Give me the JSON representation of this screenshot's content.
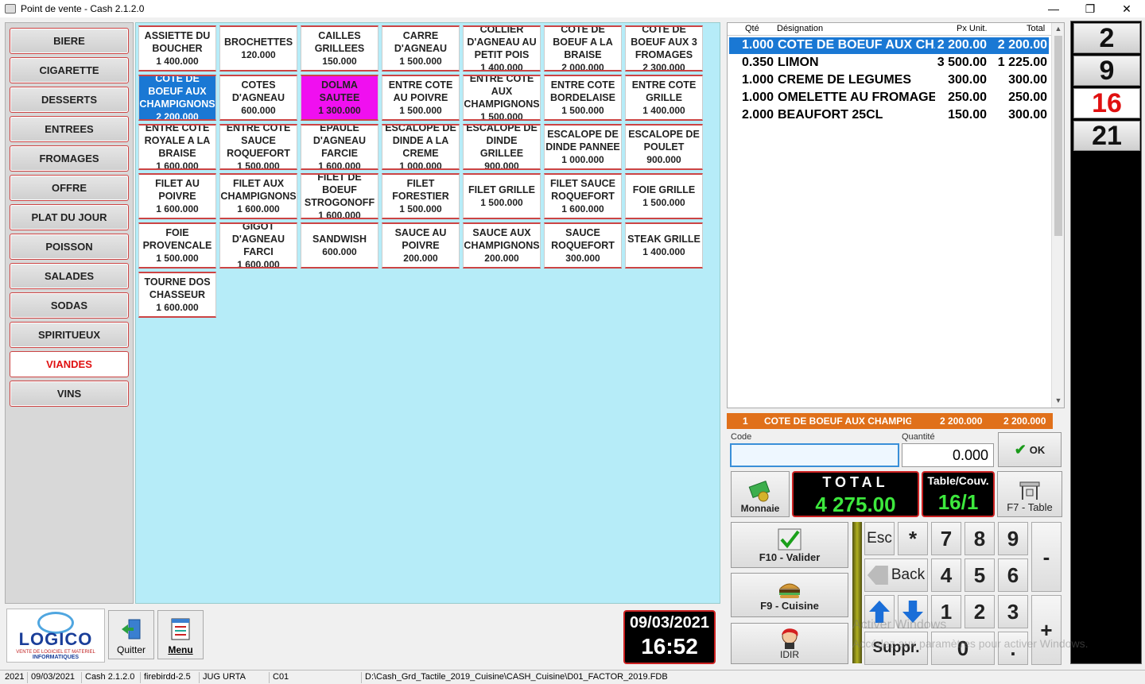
{
  "window": {
    "title": "Point de vente - Cash 2.1.2.0",
    "controls": [
      "—",
      "❐",
      "✕"
    ]
  },
  "categories": [
    "BIERE",
    "CIGARETTE",
    "DESSERTS",
    "ENTREES",
    "FROMAGES",
    "OFFRE",
    "PLAT DU JOUR",
    "POISSON",
    "SALADES",
    "SODAS",
    "SPIRITUEUX",
    "VIANDES",
    "VINS"
  ],
  "active_category": "VIANDES",
  "products": [
    {
      "name": "ASSIETTE DU BOUCHER",
      "price": "1 400.000"
    },
    {
      "name": "BROCHETTES",
      "price": "120.000"
    },
    {
      "name": "CAILLES GRILLEES",
      "price": "150.000"
    },
    {
      "name": "CARRE D'AGNEAU",
      "price": "1 500.000"
    },
    {
      "name": "COLLIER D'AGNEAU AU PETIT POIS",
      "price": "1 400.000"
    },
    {
      "name": "COTE DE BOEUF A LA BRAISE",
      "price": "2 000.000"
    },
    {
      "name": "COTE DE BOEUF AUX 3 FROMAGES",
      "price": "2 300.000"
    },
    {
      "name": "COTE DE BOEUF AUX CHAMPIGNONS",
      "price": "2 200.000",
      "state": "sel-blue"
    },
    {
      "name": "COTES D'AGNEAU",
      "price": "600.000"
    },
    {
      "name": "DOLMA SAUTEE",
      "price": "1 300.000",
      "state": "sel-pink"
    },
    {
      "name": "ENTRE COTE AU POIVRE",
      "price": "1 500.000"
    },
    {
      "name": "ENTRE COTE AUX CHAMPIGNONS",
      "price": "1 500.000"
    },
    {
      "name": "ENTRE COTE BORDELAISE",
      "price": "1 500.000"
    },
    {
      "name": "ENTRE COTE GRILLE",
      "price": "1 400.000"
    },
    {
      "name": "ENTRE COTE ROYALE A LA BRAISE",
      "price": "1 600.000"
    },
    {
      "name": "ENTRE COTE SAUCE ROQUEFORT",
      "price": "1 500.000"
    },
    {
      "name": "EPAULE D'AGNEAU FARCIE",
      "price": "1 600.000"
    },
    {
      "name": "ESCALOPE DE DINDE A LA CREME",
      "price": "1 000.000"
    },
    {
      "name": "ESCALOPE DE DINDE GRILLEE",
      "price": "900.000"
    },
    {
      "name": "ESCALOPE DE DINDE PANNEE",
      "price": "1 000.000"
    },
    {
      "name": "ESCALOPE DE POULET",
      "price": "900.000"
    },
    {
      "name": "FILET AU POIVRE",
      "price": "1 600.000"
    },
    {
      "name": "FILET AUX CHAMPIGNONS",
      "price": "1 600.000"
    },
    {
      "name": "FILET DE BOEUF STROGONOFF",
      "price": "1 600.000"
    },
    {
      "name": "FILET FORESTIER",
      "price": "1 500.000"
    },
    {
      "name": "FILET GRILLE",
      "price": "1 500.000"
    },
    {
      "name": "FILET SAUCE ROQUEFORT",
      "price": "1 600.000"
    },
    {
      "name": "FOIE GRILLE",
      "price": "1 500.000"
    },
    {
      "name": "FOIE PROVENCALE",
      "price": "1 500.000"
    },
    {
      "name": "GIGOT D'AGNEAU FARCI",
      "price": "1 600.000"
    },
    {
      "name": "SANDWISH",
      "price": "600.000"
    },
    {
      "name": "SAUCE AU POIVRE",
      "price": "200.000"
    },
    {
      "name": "SAUCE AUX CHAMPIGNONS",
      "price": "200.000"
    },
    {
      "name": "SAUCE ROQUEFORT",
      "price": "300.000"
    },
    {
      "name": "STEAK GRILLE",
      "price": "1 400.000"
    },
    {
      "name": "TOURNE DOS CHASSEUR",
      "price": "1 600.000"
    }
  ],
  "order": {
    "headers": {
      "qty": "Qté",
      "designation": "Désignation",
      "unit_price": "Px Unit.",
      "total": "Total"
    },
    "lines": [
      {
        "qty": "1.000",
        "designation": "COTE DE BOEUF AUX CHAMPIGNONS",
        "unit_price": "2 200.00",
        "total": "2 200.00",
        "selected": true
      },
      {
        "qty": "0.350",
        "designation": "LIMON",
        "unit_price": "3 500.00",
        "total": "1 225.00"
      },
      {
        "qty": "1.000",
        "designation": "CREME DE LEGUMES",
        "unit_price": "300.00",
        "total": "300.00"
      },
      {
        "qty": "1.000",
        "designation": "OMELETTE AU FROMAGE",
        "unit_price": "250.00",
        "total": "250.00"
      },
      {
        "qty": "2.000",
        "designation": "BEAUFORT 25CL",
        "unit_price": "150.00",
        "total": "300.00"
      }
    ]
  },
  "selected_line": {
    "index": "1",
    "designation": "COTE DE BOEUF AUX CHAMPIGNONS",
    "unit_price": "2 200.000",
    "total": "2 200.000"
  },
  "inputs": {
    "code_label": "Code",
    "code_value": "",
    "qty_label": "Quantité",
    "qty_value": "0.000"
  },
  "buttons": {
    "ok": "OK",
    "monnaie": "Monnaie",
    "table": "F7 - Table",
    "valider": "F10 - Valider",
    "cuisine": "F9 - Cuisine",
    "user": "IDIR",
    "esc": "Esc",
    "star": "*",
    "back": "Back",
    "minus": "-",
    "plus": "+",
    "suppr": "Suppr.",
    "dot": ".",
    "quit": "Quitter",
    "menu": "Menu"
  },
  "numpad": [
    "7",
    "8",
    "9",
    "4",
    "5",
    "6",
    "1",
    "2",
    "3",
    "0"
  ],
  "total": {
    "label": "TOTAL",
    "value": "4 275.00"
  },
  "table_couv": {
    "label": "Table/Couv.",
    "value": "16/1"
  },
  "tables": [
    "2",
    "9",
    "16",
    "21"
  ],
  "active_table": "16",
  "clock": {
    "date": "09/03/2021",
    "time": "16:52"
  },
  "logo": {
    "text": "LOGICO",
    "sub1": "VENTE DE LOGICIEL ET MATERIEL",
    "sub2": "INFORMATIQUES"
  },
  "status": [
    "2021",
    "09/03/2021",
    "Cash 2.1.2.0",
    "firebirdd-2.5",
    "JUG URTA",
    "C01",
    "D:\\Cash_Grd_Tactile_2019_Cuisine\\CASH_Cuisine\\D01_FACTOR_2019.FDB"
  ],
  "watermark": {
    "line1": "Activer Windows",
    "line2": "Accédez aux paramètres pour activer Windows."
  }
}
